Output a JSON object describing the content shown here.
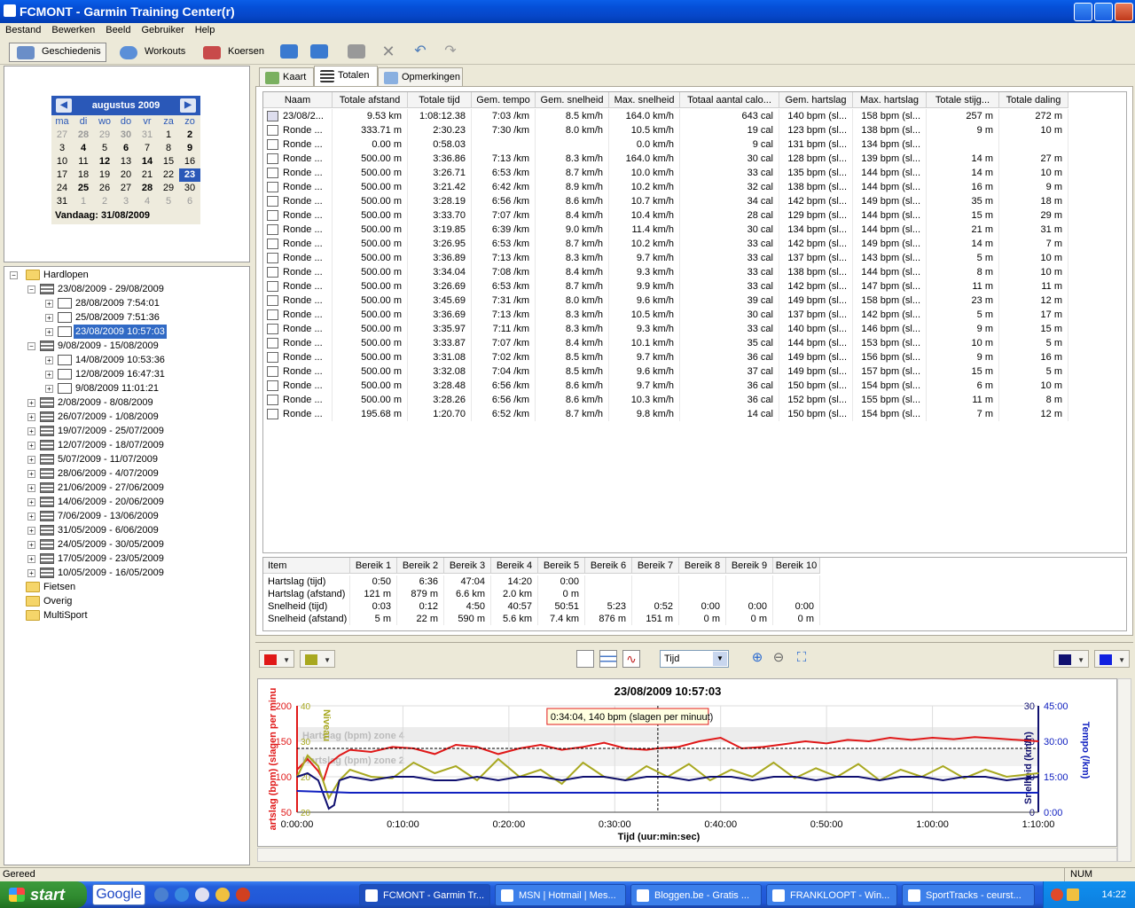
{
  "window": {
    "title": "FCMONT - Garmin Training Center(r)"
  },
  "menu": [
    "Bestand",
    "Bewerken",
    "Beeld",
    "Gebruiker",
    "Help"
  ],
  "toolbar": {
    "history": "Geschiedenis",
    "workouts": "Workouts",
    "courses": "Koersen"
  },
  "calendar": {
    "month": "augustus 2009",
    "days": [
      "ma",
      "di",
      "wo",
      "do",
      "vr",
      "za",
      "zo"
    ],
    "weeks": [
      [
        [
          "27",
          "o"
        ],
        [
          "28",
          "ob"
        ],
        [
          "29",
          "o"
        ],
        [
          "30",
          "ob"
        ],
        [
          "31",
          "o"
        ],
        [
          "1",
          ""
        ],
        [
          "2",
          "b"
        ]
      ],
      [
        [
          "3",
          ""
        ],
        [
          "4",
          "b"
        ],
        [
          "5",
          ""
        ],
        [
          "6",
          "b"
        ],
        [
          "7",
          ""
        ],
        [
          "8",
          ""
        ],
        [
          "9",
          "b"
        ]
      ],
      [
        [
          "10",
          ""
        ],
        [
          "11",
          ""
        ],
        [
          "12",
          "b"
        ],
        [
          "13",
          ""
        ],
        [
          "14",
          "b"
        ],
        [
          "15",
          ""
        ],
        [
          "16",
          ""
        ]
      ],
      [
        [
          "17",
          ""
        ],
        [
          "18",
          ""
        ],
        [
          "19",
          ""
        ],
        [
          "20",
          ""
        ],
        [
          "21",
          ""
        ],
        [
          "22",
          ""
        ],
        [
          "23",
          "s"
        ]
      ],
      [
        [
          "24",
          ""
        ],
        [
          "25",
          "b"
        ],
        [
          "26",
          ""
        ],
        [
          "27",
          ""
        ],
        [
          "28",
          "b"
        ],
        [
          "29",
          ""
        ],
        [
          "30",
          ""
        ]
      ],
      [
        [
          "31",
          ""
        ],
        [
          "1",
          "o"
        ],
        [
          "2",
          "o"
        ],
        [
          "3",
          "o"
        ],
        [
          "4",
          "o"
        ],
        [
          "5",
          "o"
        ],
        [
          "6",
          "o"
        ]
      ]
    ],
    "today": "Vandaag: 31/08/2009"
  },
  "tree": [
    {
      "l": "Hardlopen",
      "d": 0,
      "t": "fold",
      "e": "-"
    },
    {
      "l": "23/08/2009 - 29/08/2009",
      "d": 1,
      "t": "wk",
      "e": "-"
    },
    {
      "l": "28/08/2009 7:54:01",
      "d": 2,
      "t": "act",
      "e": "+"
    },
    {
      "l": "25/08/2009 7:51:36",
      "d": 2,
      "t": "act",
      "e": "+"
    },
    {
      "l": "23/08/2009 10:57:03",
      "d": 2,
      "t": "act",
      "e": "+",
      "sel": true
    },
    {
      "l": "9/08/2009 - 15/08/2009",
      "d": 1,
      "t": "wk",
      "e": "-"
    },
    {
      "l": "14/08/2009 10:53:36",
      "d": 2,
      "t": "act",
      "e": "+"
    },
    {
      "l": "12/08/2009 16:47:31",
      "d": 2,
      "t": "act",
      "e": "+"
    },
    {
      "l": "9/08/2009 11:01:21",
      "d": 2,
      "t": "act",
      "e": "+"
    },
    {
      "l": "2/08/2009 - 8/08/2009",
      "d": 1,
      "t": "wk",
      "e": "+"
    },
    {
      "l": "26/07/2009 - 1/08/2009",
      "d": 1,
      "t": "wk",
      "e": "+"
    },
    {
      "l": "19/07/2009 - 25/07/2009",
      "d": 1,
      "t": "wk",
      "e": "+"
    },
    {
      "l": "12/07/2009 - 18/07/2009",
      "d": 1,
      "t": "wk",
      "e": "+"
    },
    {
      "l": "5/07/2009 - 11/07/2009",
      "d": 1,
      "t": "wk",
      "e": "+"
    },
    {
      "l": "28/06/2009 - 4/07/2009",
      "d": 1,
      "t": "wk",
      "e": "+"
    },
    {
      "l": "21/06/2009 - 27/06/2009",
      "d": 1,
      "t": "wk",
      "e": "+"
    },
    {
      "l": "14/06/2009 - 20/06/2009",
      "d": 1,
      "t": "wk",
      "e": "+"
    },
    {
      "l": "7/06/2009 - 13/06/2009",
      "d": 1,
      "t": "wk",
      "e": "+"
    },
    {
      "l": "31/05/2009 - 6/06/2009",
      "d": 1,
      "t": "wk",
      "e": "+"
    },
    {
      "l": "24/05/2009 - 30/05/2009",
      "d": 1,
      "t": "wk",
      "e": "+"
    },
    {
      "l": "17/05/2009 - 23/05/2009",
      "d": 1,
      "t": "wk",
      "e": "+"
    },
    {
      "l": "10/05/2009 - 16/05/2009",
      "d": 1,
      "t": "wk",
      "e": "+"
    },
    {
      "l": "Fietsen",
      "d": 0,
      "t": "fold",
      "e": ""
    },
    {
      "l": "Overig",
      "d": 0,
      "t": "fold",
      "e": ""
    },
    {
      "l": "MultiSport",
      "d": 0,
      "t": "fold",
      "e": ""
    }
  ],
  "tabs": [
    "Kaart",
    "Totalen",
    "Opmerkingen"
  ],
  "laps": {
    "headers": [
      "Naam",
      "Totale afstand",
      "Totale tijd",
      "Gem. tempo",
      "Gem. snelheid",
      "Max. snelheid",
      "Totaal aantal calo...",
      "Gem. hartslag",
      "Max. hartslag",
      "Totale stijg...",
      "Totale daling"
    ],
    "rows": [
      [
        "23/08/2...",
        "9.53 km",
        "1:08:12.38",
        "7:03 /km",
        "8.5 km/h",
        "164.0 km/h",
        "643 cal",
        "140 bpm (sl...",
        "158 bpm (sl...",
        "257 m",
        "272 m"
      ],
      [
        "Ronde ...",
        "333.71 m",
        "2:30.23",
        "7:30 /km",
        "8.0 km/h",
        "10.5 km/h",
        "19 cal",
        "123 bpm (sl...",
        "138 bpm (sl...",
        "9 m",
        "10 m"
      ],
      [
        "Ronde ...",
        "0.00 m",
        "0:58.03",
        "",
        "",
        "0.0 km/h",
        "9 cal",
        "131 bpm (sl...",
        "134 bpm (sl...",
        "",
        ""
      ],
      [
        "Ronde ...",
        "500.00 m",
        "3:36.86",
        "7:13 /km",
        "8.3 km/h",
        "164.0 km/h",
        "30 cal",
        "128 bpm (sl...",
        "139 bpm (sl...",
        "14 m",
        "27 m"
      ],
      [
        "Ronde ...",
        "500.00 m",
        "3:26.71",
        "6:53 /km",
        "8.7 km/h",
        "10.0 km/h",
        "33 cal",
        "135 bpm (sl...",
        "144 bpm (sl...",
        "14 m",
        "10 m"
      ],
      [
        "Ronde ...",
        "500.00 m",
        "3:21.42",
        "6:42 /km",
        "8.9 km/h",
        "10.2 km/h",
        "32 cal",
        "138 bpm (sl...",
        "144 bpm (sl...",
        "16 m",
        "9 m"
      ],
      [
        "Ronde ...",
        "500.00 m",
        "3:28.19",
        "6:56 /km",
        "8.6 km/h",
        "10.7 km/h",
        "34 cal",
        "142 bpm (sl...",
        "149 bpm (sl...",
        "35 m",
        "18 m"
      ],
      [
        "Ronde ...",
        "500.00 m",
        "3:33.70",
        "7:07 /km",
        "8.4 km/h",
        "10.4 km/h",
        "28 cal",
        "129 bpm (sl...",
        "144 bpm (sl...",
        "15 m",
        "29 m"
      ],
      [
        "Ronde ...",
        "500.00 m",
        "3:19.85",
        "6:39 /km",
        "9.0 km/h",
        "11.4 km/h",
        "30 cal",
        "134 bpm (sl...",
        "144 bpm (sl...",
        "21 m",
        "31 m"
      ],
      [
        "Ronde ...",
        "500.00 m",
        "3:26.95",
        "6:53 /km",
        "8.7 km/h",
        "10.2 km/h",
        "33 cal",
        "142 bpm (sl...",
        "149 bpm (sl...",
        "14 m",
        "7 m"
      ],
      [
        "Ronde ...",
        "500.00 m",
        "3:36.89",
        "7:13 /km",
        "8.3 km/h",
        "9.7 km/h",
        "33 cal",
        "137 bpm (sl...",
        "143 bpm (sl...",
        "5 m",
        "10 m"
      ],
      [
        "Ronde ...",
        "500.00 m",
        "3:34.04",
        "7:08 /km",
        "8.4 km/h",
        "9.3 km/h",
        "33 cal",
        "138 bpm (sl...",
        "144 bpm (sl...",
        "8 m",
        "10 m"
      ],
      [
        "Ronde ...",
        "500.00 m",
        "3:26.69",
        "6:53 /km",
        "8.7 km/h",
        "9.9 km/h",
        "33 cal",
        "142 bpm (sl...",
        "147 bpm (sl...",
        "11 m",
        "11 m"
      ],
      [
        "Ronde ...",
        "500.00 m",
        "3:45.69",
        "7:31 /km",
        "8.0 km/h",
        "9.6 km/h",
        "39 cal",
        "149 bpm (sl...",
        "158 bpm (sl...",
        "23 m",
        "12 m"
      ],
      [
        "Ronde ...",
        "500.00 m",
        "3:36.69",
        "7:13 /km",
        "8.3 km/h",
        "10.5 km/h",
        "30 cal",
        "137 bpm (sl...",
        "142 bpm (sl...",
        "5 m",
        "17 m"
      ],
      [
        "Ronde ...",
        "500.00 m",
        "3:35.97",
        "7:11 /km",
        "8.3 km/h",
        "9.3 km/h",
        "33 cal",
        "140 bpm (sl...",
        "146 bpm (sl...",
        "9 m",
        "15 m"
      ],
      [
        "Ronde ...",
        "500.00 m",
        "3:33.87",
        "7:07 /km",
        "8.4 km/h",
        "10.1 km/h",
        "35 cal",
        "144 bpm (sl...",
        "153 bpm (sl...",
        "10 m",
        "5 m"
      ],
      [
        "Ronde ...",
        "500.00 m",
        "3:31.08",
        "7:02 /km",
        "8.5 km/h",
        "9.7 km/h",
        "36 cal",
        "149 bpm (sl...",
        "156 bpm (sl...",
        "9 m",
        "16 m"
      ],
      [
        "Ronde ...",
        "500.00 m",
        "3:32.08",
        "7:04 /km",
        "8.5 km/h",
        "9.6 km/h",
        "37 cal",
        "149 bpm (sl...",
        "157 bpm (sl...",
        "15 m",
        "5 m"
      ],
      [
        "Ronde ...",
        "500.00 m",
        "3:28.48",
        "6:56 /km",
        "8.6 km/h",
        "9.7 km/h",
        "36 cal",
        "150 bpm (sl...",
        "154 bpm (sl...",
        "6 m",
        "10 m"
      ],
      [
        "Ronde ...",
        "500.00 m",
        "3:28.26",
        "6:56 /km",
        "8.6 km/h",
        "10.3 km/h",
        "36 cal",
        "152 bpm (sl...",
        "155 bpm (sl...",
        "11 m",
        "8 m"
      ],
      [
        "Ronde ...",
        "195.68 m",
        "1:20.70",
        "6:52 /km",
        "8.7 km/h",
        "9.8 km/h",
        "14 cal",
        "150 bpm (sl...",
        "154 bpm (sl...",
        "7 m",
        "12 m"
      ]
    ]
  },
  "zones": {
    "headers": [
      "Item",
      "Bereik 1",
      "Bereik 2",
      "Bereik 3",
      "Bereik 4",
      "Bereik 5",
      "Bereik 6",
      "Bereik 7",
      "Bereik 8",
      "Bereik 9",
      "Bereik 10"
    ],
    "rows": [
      [
        "Hartslag (tijd)",
        "0:50",
        "6:36",
        "47:04",
        "14:20",
        "0:00",
        "",
        "",
        "",
        "",
        ""
      ],
      [
        "Hartslag (afstand)",
        "121 m",
        "879 m",
        "6.6 km",
        "2.0 km",
        "0 m",
        "",
        "",
        "",
        "",
        ""
      ],
      [
        "Snelheid (tijd)",
        "0:03",
        "0:12",
        "4:50",
        "40:57",
        "50:51",
        "5:23",
        "0:52",
        "0:00",
        "0:00",
        "0:00"
      ],
      [
        "Snelheid (afstand)",
        "5 m",
        "22 m",
        "590 m",
        "5.6 km",
        "7.4 km",
        "876 m",
        "151 m",
        "0 m",
        "0 m",
        "0 m"
      ]
    ]
  },
  "graph": {
    "xaxis_select": "Tijd",
    "title": "23/08/2009 10:57:03",
    "tooltip": "0:34:04, 140 bpm (slagen per minuut)",
    "ylabel_left": "artslag (bpm) (slagen per minu",
    "ylabel_left2": "Niveau",
    "ylabel_right": "Snelheid (km/h)",
    "ylabel_right2": "Tempo (/km)",
    "xlabel": "Tijd (uur:min:sec)",
    "zone_labels": [
      "Hartslag (bpm) zone 4",
      "Hartslag (bpm) zone 2"
    ],
    "colors": {
      "hr": "#e01818",
      "level": "#a8a820",
      "speed": "#101070",
      "pace": "#1020c0"
    }
  },
  "chart_data": {
    "type": "line",
    "title": "23/08/2009 10:57:03",
    "xlabel": "Tijd (uur:min:sec)",
    "x_ticks": [
      "0:00:00",
      "0:10:00",
      "0:20:00",
      "0:30:00",
      "0:40:00",
      "0:50:00",
      "1:00:00",
      "1:10:00"
    ],
    "xlim_minutes": [
      0,
      70
    ],
    "y_left": {
      "label": "artslag (bpm) (slagen per minu",
      "ticks": [
        "200",
        "150",
        "100",
        "50"
      ],
      "ylim": [
        50,
        200
      ]
    },
    "y_left2": {
      "label": "Niveau",
      "ticks": [
        "40",
        "30",
        "20",
        "20"
      ]
    },
    "y_right": {
      "label": "Snelheid (km/h)",
      "ticks": [
        "30",
        "20",
        "10",
        "0"
      ],
      "ylim": [
        0,
        30
      ]
    },
    "y_right2": {
      "label": "Tempo (/km)",
      "ticks": [
        "45:00",
        "30:00",
        "15:00",
        "0:00"
      ]
    },
    "series": [
      {
        "name": "Hartslag",
        "axis": "left",
        "color": "#e01818",
        "x": [
          0,
          1,
          2,
          2.5,
          3,
          4,
          5,
          7,
          9,
          11,
          13,
          15,
          17,
          19,
          21,
          23,
          25,
          27,
          29,
          31,
          33,
          34,
          36,
          38,
          40,
          42,
          44,
          46,
          48,
          50,
          52,
          54,
          56,
          58,
          60,
          62,
          64,
          66,
          68,
          70
        ],
        "y": [
          110,
          125,
          108,
          95,
          118,
          130,
          138,
          135,
          142,
          140,
          132,
          145,
          142,
          132,
          140,
          145,
          138,
          142,
          148,
          140,
          138,
          140,
          142,
          150,
          155,
          140,
          142,
          146,
          150,
          147,
          152,
          150,
          155,
          152,
          155,
          153,
          156,
          154,
          152,
          150
        ]
      },
      {
        "name": "Niveau",
        "axis": "left",
        "color": "#a8a820",
        "x": [
          0,
          1,
          2,
          3,
          4,
          5,
          7,
          9,
          11,
          13,
          15,
          17,
          19,
          21,
          23,
          25,
          27,
          29,
          31,
          33,
          35,
          37,
          39,
          41,
          43,
          45,
          47,
          49,
          51,
          53,
          55,
          57,
          59,
          61,
          63,
          65,
          67,
          70
        ],
        "y": [
          100,
          130,
          115,
          70,
          95,
          110,
          100,
          98,
          120,
          105,
          115,
          95,
          125,
          100,
          110,
          90,
          120,
          100,
          95,
          115,
          100,
          118,
          95,
          110,
          100,
          120,
          98,
          112,
          100,
          118,
          95,
          110,
          100,
          115,
          98,
          110,
          100,
          105
        ]
      },
      {
        "name": "Snelheid",
        "axis": "right",
        "color": "#101070",
        "x": [
          0,
          1,
          2,
          3,
          3.5,
          4,
          5,
          7,
          9,
          11,
          13,
          15,
          17,
          19,
          21,
          23,
          25,
          27,
          29,
          31,
          33,
          35,
          37,
          39,
          41,
          43,
          45,
          47,
          49,
          51,
          53,
          55,
          57,
          59,
          61,
          63,
          65,
          67,
          70
        ],
        "y": [
          10,
          11,
          9,
          1,
          2,
          9,
          10,
          9,
          10,
          10,
          9,
          9,
          10,
          9,
          10,
          10,
          9,
          10,
          10,
          9,
          10,
          10,
          9,
          10,
          10,
          9,
          10,
          10,
          9,
          10,
          10,
          9,
          10,
          10,
          9,
          10,
          10,
          9,
          10
        ]
      },
      {
        "name": "Tempo",
        "axis": "right",
        "color": "#1020c0",
        "x": [
          0,
          5,
          10,
          20,
          30,
          40,
          50,
          60,
          70
        ],
        "y": [
          6,
          5.5,
          5.5,
          5.5,
          5.5,
          5.5,
          5.5,
          5.5,
          5.5
        ]
      }
    ]
  },
  "status": {
    "text": "Gereed",
    "num": "NUM"
  },
  "taskbar": {
    "start": "start",
    "google": "Google",
    "tasks": [
      "FCMONT - Garmin Tr...",
      "MSN | Hotmail | Mes...",
      "Bloggen.be - Gratis ...",
      "FRANKLOOPT - Win...",
      "SportTracks - ceurst..."
    ],
    "clock": "14:22"
  }
}
